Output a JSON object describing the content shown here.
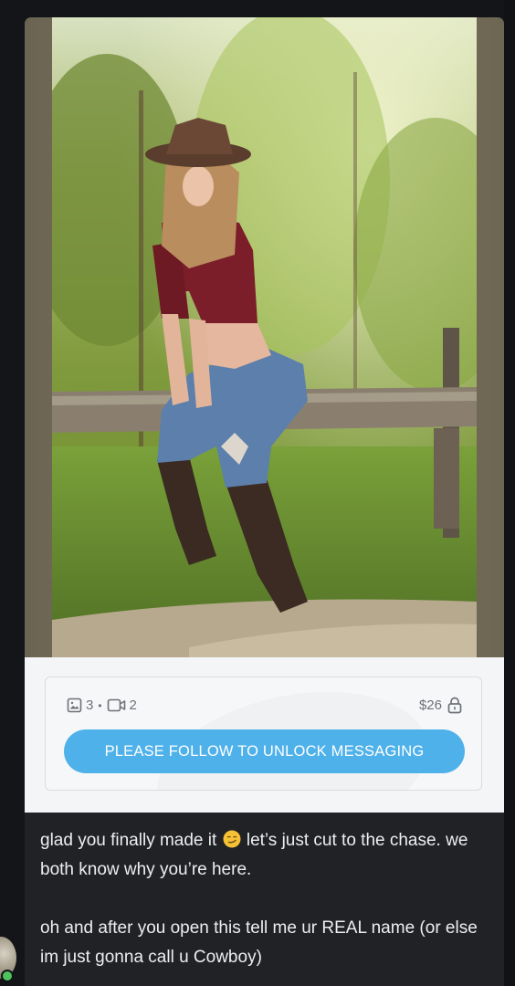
{
  "media": {
    "image_description_icon": "cowgirl-photo"
  },
  "locked": {
    "photo_count": "3",
    "separator": "•",
    "video_count": "2",
    "price": "$26",
    "unlock_button_label": "PLEASE FOLLOW TO UNLOCK MESSAGING",
    "button_color": "#4fb1ea"
  },
  "message": {
    "line1_before_emoji": "glad you finally made it",
    "emoji": "smirking-face",
    "line1_after_emoji": " let’s just cut to the chase. we both know why you’re here.",
    "line2": "oh and after you open this tell me ur REAL name (or else im just gonna call u Cowboy)"
  },
  "sender": {
    "status_color": "#4cc45b"
  }
}
